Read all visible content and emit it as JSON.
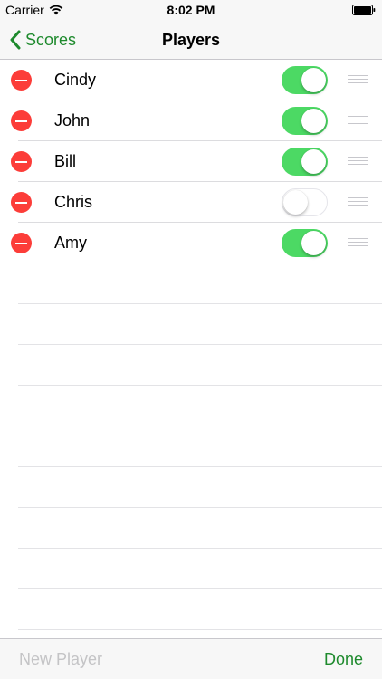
{
  "status_bar": {
    "carrier": "Carrier",
    "time": "8:02 PM",
    "icons": [
      "wifi-icon",
      "battery-icon"
    ]
  },
  "nav": {
    "back_label": "Scores",
    "back_icon": "chevron-left-icon",
    "title": "Players"
  },
  "players": [
    {
      "name": "Cindy",
      "enabled": true
    },
    {
      "name": "John",
      "enabled": true
    },
    {
      "name": "Bill",
      "enabled": true
    },
    {
      "name": "Chris",
      "enabled": false
    },
    {
      "name": "Amy",
      "enabled": true
    }
  ],
  "toolbar": {
    "new_player_label": "New Player",
    "new_player_enabled": false,
    "done_label": "Done"
  },
  "colors": {
    "accent": "#1e8a2d",
    "toggle_on": "#4cd964",
    "delete": "#fc3d39",
    "disabled_text": "#c4c4c6"
  }
}
